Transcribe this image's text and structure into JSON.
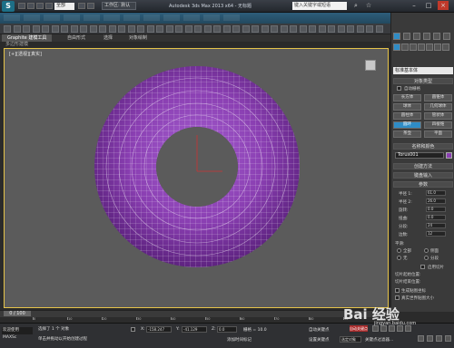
{
  "app": {
    "title": "Autodesk 3ds Max 2013 x64 - 无标题",
    "workspace": "工作区: 默认",
    "search_placeholder": "键入关键字或短语",
    "quick_access_dropdown": "全部"
  },
  "ribbon": {
    "tabs": [
      "Graphite 建模工具",
      "自由形式",
      "选择",
      "对象绘制"
    ],
    "subtitle": "多边形建模"
  },
  "viewport": {
    "label": "[+][透视][真实]",
    "torus_color": "#8a3fb2"
  },
  "command_panel": {
    "category_dropdown": "标准基本体",
    "object_type_title": "对象类型",
    "autogrid_label": "自动栅格",
    "buttons": [
      "长方体",
      "圆锥体",
      "球体",
      "几何球体",
      "圆柱体",
      "管状体",
      "圆环",
      "四棱锥",
      "茶壶",
      "平面"
    ],
    "active_button": "圆环",
    "name_color_title": "名称和颜色",
    "object_name": "Torus001",
    "object_color": "#8a3fb2",
    "creation_method_title": "创建方法",
    "keyboard_entry_title": "键盘输入",
    "parameters_title": "参数",
    "params": [
      {
        "label": "半径 1:",
        "value": "61.0"
      },
      {
        "label": "半径 2:",
        "value": "26.0"
      },
      {
        "label": "旋转:",
        "value": "0.0"
      },
      {
        "label": "扭曲:",
        "value": "0.0"
      },
      {
        "label": "分段:",
        "value": "24"
      },
      {
        "label": "边数:",
        "value": "12"
      }
    ],
    "smooth_label": "平滑:",
    "smooth_options": [
      "全部",
      "侧面",
      "无",
      "分段"
    ],
    "slice_on_label": "启用切片",
    "slice_from_label": "切片起始位置:",
    "slice_to_label": "切片结束位置:",
    "gen_map_label": "生成贴图坐标",
    "real_world_label": "真实世界贴图大小"
  },
  "timeline": {
    "slider_label": "0 / 100",
    "ticks": [
      "0",
      "10",
      "20",
      "30",
      "40",
      "50",
      "60",
      "70",
      "80",
      "90",
      "100"
    ]
  },
  "status": {
    "selection": "选择了 1 个 对象",
    "prompt": "单击并拖动以开始创建过程",
    "welcome": "欢迎使用 MAXSc",
    "x_label": "X:",
    "x_value": "-158.247",
    "y_label": "Y:",
    "y_value": "-41.129",
    "z_label": "Z:",
    "z_value": "0.0",
    "grid_label": "栅格 = 10.0",
    "auto_key": "自动关键点",
    "set_key": "设置关键点",
    "selected_dropdown": "选定对象",
    "add_time_tag": "添加时间标记",
    "key_filter": "关键点过滤器..."
  },
  "watermark": {
    "text": "Bai 经验",
    "url": "jingyan.baidu.com"
  }
}
